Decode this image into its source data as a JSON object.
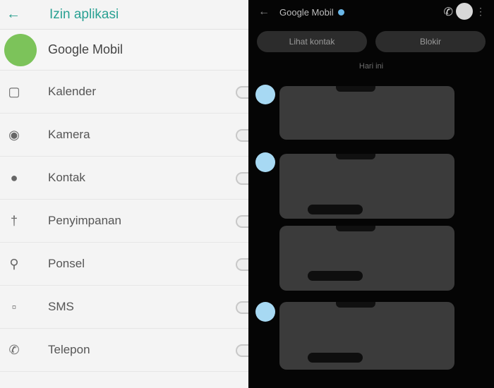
{
  "left": {
    "back_icon": "arrow-left-icon",
    "title": "Izin aplikasi",
    "app": {
      "name": "Google Mobil"
    },
    "permissions": [
      {
        "label": "Kalender",
        "icon": "calendar-icon"
      },
      {
        "label": "Kamera",
        "icon": "camera-icon"
      },
      {
        "label": "Kontak",
        "icon": "contacts-icon"
      },
      {
        "label": "Penyimpanan",
        "icon": "storage-icon"
      },
      {
        "label": "Ponsel",
        "icon": "phone-icon"
      },
      {
        "label": "SMS",
        "icon": "sms-icon"
      },
      {
        "label": "Telepon",
        "icon": "telephone-icon"
      }
    ]
  },
  "chat": {
    "contact_name": "Google Mobil",
    "actions": [
      "Lihat kontak",
      "Blokir"
    ],
    "day_label": "Hari ini",
    "messages": [
      {
        "text": "",
        "has_link": false,
        "time": ""
      },
      {
        "text": "",
        "has_link": true,
        "time": ""
      },
      {
        "text": "",
        "has_link": true,
        "time": ""
      },
      {
        "text": "",
        "has_link": true,
        "time": ""
      }
    ]
  },
  "colors": {
    "accent": "#2aa193",
    "app_icon": "#7cc35a",
    "dark_bg": "#050505",
    "bubble": "#3b3b3b",
    "dot": "#a7d9f3"
  }
}
